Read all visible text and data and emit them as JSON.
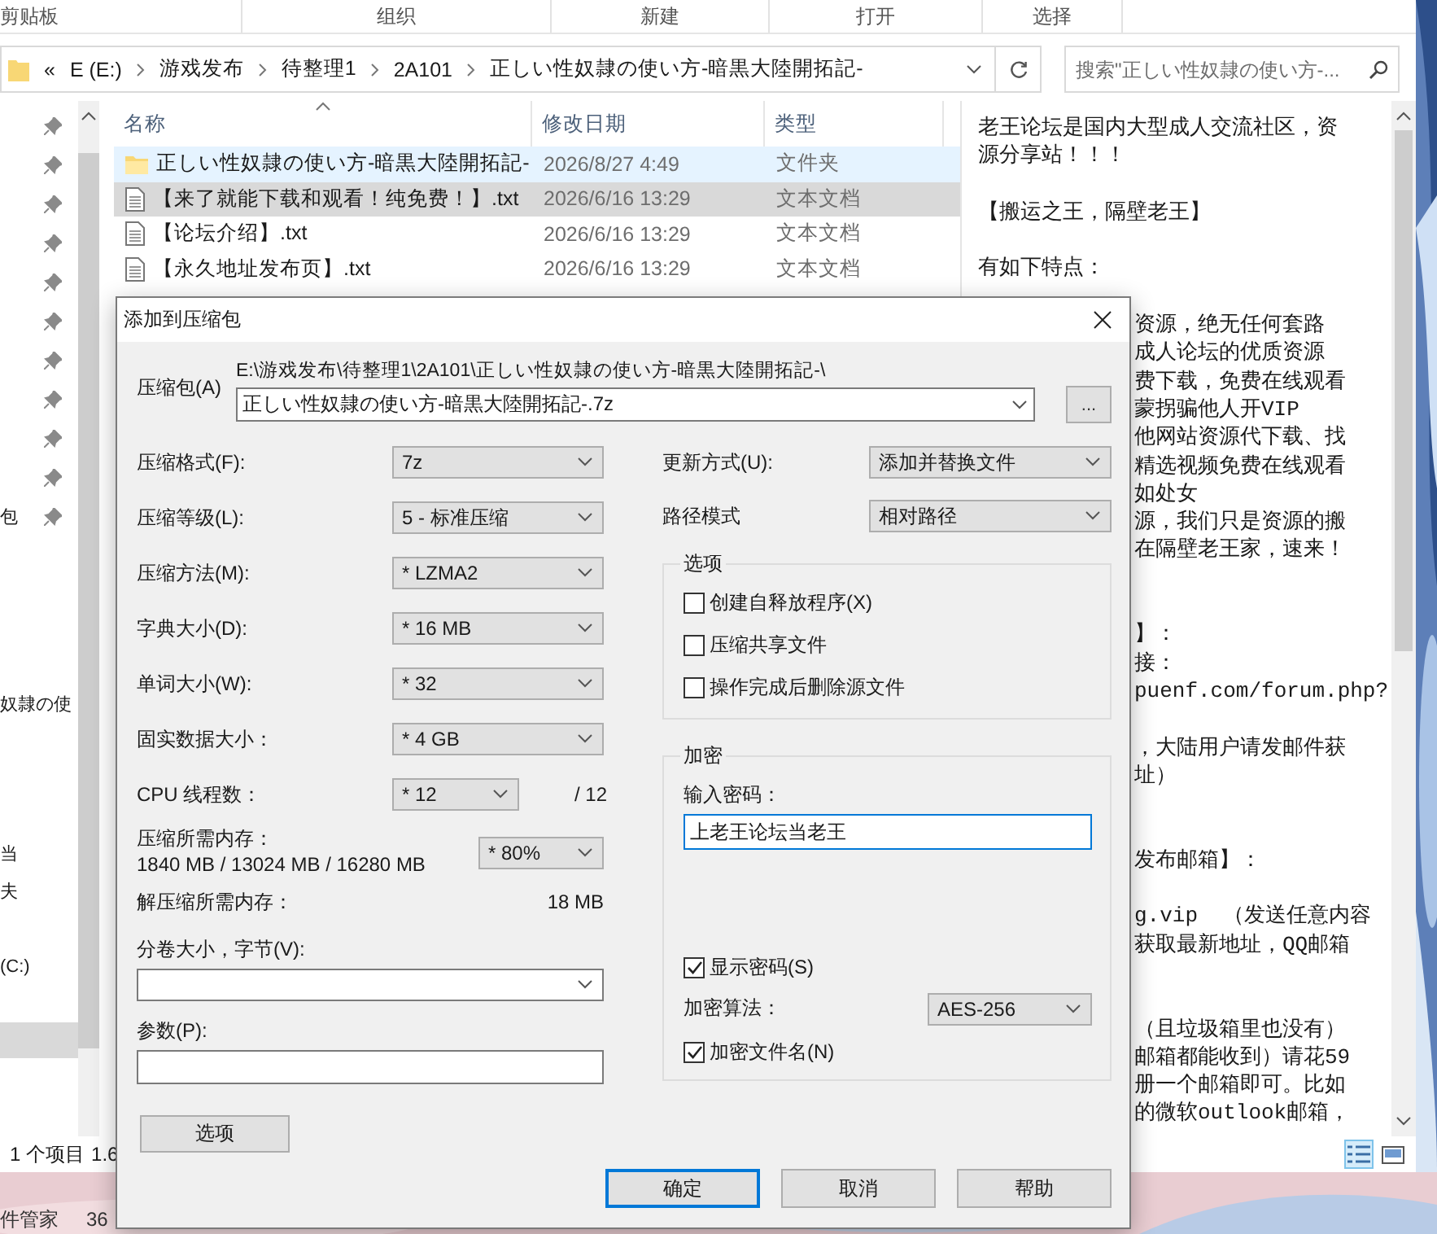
{
  "ribbon": {
    "groups": [
      "剪贴板",
      "组织",
      "新建",
      "打开",
      "选择"
    ]
  },
  "address": {
    "back": "«",
    "path": [
      "E (E:)",
      "游戏发布",
      "待整理1",
      "2A101",
      "正しい性奴隷の使い方-暗黒大陸開拓記-"
    ],
    "search": {
      "placeholder": "搜索\"正しい性奴隷の使い方-..."
    }
  },
  "nav": {
    "items": [
      {
        "kind": "pinned",
        "selected": false
      },
      {
        "kind": "pinned",
        "selected": false
      },
      {
        "kind": "pinned",
        "selected": false
      },
      {
        "kind": "pinned",
        "selected": false
      },
      {
        "kind": "pinned",
        "selected": false
      },
      {
        "kind": "pinned",
        "selected": false
      },
      {
        "kind": "pinned",
        "selected": false
      },
      {
        "kind": "pinned",
        "selected": false
      },
      {
        "kind": "pinned",
        "selected": false
      },
      {
        "kind": "pinned",
        "selected": false
      },
      {
        "kind": "pinned",
        "text": "包",
        "selected": false
      },
      {
        "kind": "blank",
        "selected": false
      },
      {
        "kind": "blank",
        "selected": false
      },
      {
        "kind": "blank",
        "selected": false
      },
      {
        "kind": "blank",
        "selected": false
      },
      {
        "kind": "label",
        "text": "奴隷の使",
        "selected": false
      },
      {
        "kind": "blank",
        "selected": false
      },
      {
        "kind": "blank",
        "selected": false
      },
      {
        "kind": "blank",
        "selected": false
      },
      {
        "kind": "label",
        "text": "当",
        "selected": false
      },
      {
        "kind": "label",
        "text": "夫",
        "selected": false
      },
      {
        "kind": "blank",
        "selected": false
      },
      {
        "kind": "label",
        "text": "(C:)",
        "selected": false
      },
      {
        "kind": "blank",
        "selected": false
      },
      {
        "kind": "blank",
        "selected": true
      }
    ]
  },
  "files": {
    "columns": [
      "名称",
      "修改日期",
      "类型"
    ],
    "rows": [
      {
        "kind": "folder",
        "name": "正しい性奴隷の使い方-暗黒大陸開拓記-",
        "date": "2026/8/27 4:49",
        "type": "文件夹",
        "hovered": true,
        "selected": false
      },
      {
        "kind": "text",
        "name": "【来了就能下载和观看！纯免费！】.txt",
        "date": "2026/6/16 13:29",
        "type": "文本文档",
        "hovered": false,
        "selected": true
      },
      {
        "kind": "text",
        "name": "【论坛介绍】.txt",
        "date": "2026/6/16 13:29",
        "type": "文本文档",
        "hovered": false,
        "selected": false
      },
      {
        "kind": "text",
        "name": "【永久地址发布页】.txt",
        "date": "2026/6/16 13:29",
        "type": "文本文档",
        "hovered": false,
        "selected": false
      }
    ]
  },
  "preview": {
    "lines": [
      {
        "kind": "full",
        "text": "老王论坛是国内大型成人交流社区，资"
      },
      {
        "kind": "full",
        "text": "源分享站！！！"
      },
      {
        "kind": "blank"
      },
      {
        "kind": "full",
        "text": "【搬运之王，隔壁老王】"
      },
      {
        "kind": "blank"
      },
      {
        "kind": "full",
        "text": "有如下特点："
      },
      {
        "kind": "blank"
      },
      {
        "kind": "partial",
        "text": "资源，绝无任何套路"
      },
      {
        "kind": "partial",
        "text": "成人论坛的优质资源"
      },
      {
        "kind": "partial",
        "text": "费下载，免费在线观看"
      },
      {
        "kind": "partial",
        "text": "蒙拐骗他人开VIP"
      },
      {
        "kind": "partial",
        "text": "他网站资源代下载、找"
      },
      {
        "kind": "partial",
        "text": "精选视频免费在线观看"
      },
      {
        "kind": "partial",
        "text": "如处女"
      },
      {
        "kind": "partial",
        "text": "源，我们只是资源的搬"
      },
      {
        "kind": "partial",
        "text": "在隔壁老王家，速来！"
      },
      {
        "kind": "blank"
      },
      {
        "kind": "blank"
      },
      {
        "kind": "partial",
        "text": "】："
      },
      {
        "kind": "partial",
        "text": "接："
      },
      {
        "kind": "partial",
        "text": "puenf.com/forum.php?"
      },
      {
        "kind": "blank"
      },
      {
        "kind": "partial",
        "text": "，大陆用户请发邮件获"
      },
      {
        "kind": "partial",
        "text": "址）"
      },
      {
        "kind": "blank"
      },
      {
        "kind": "blank"
      },
      {
        "kind": "partial",
        "text": "发布邮箱】："
      },
      {
        "kind": "blank"
      },
      {
        "kind": "partial",
        "text": "g.vip  （发送任意内容"
      },
      {
        "kind": "partial",
        "text": "获取最新地址，QQ邮箱"
      },
      {
        "kind": "blank"
      },
      {
        "kind": "blank"
      },
      {
        "kind": "partial",
        "text": "（且垃圾箱里也没有）"
      },
      {
        "kind": "partial",
        "text": "邮箱都能收到）请花59"
      },
      {
        "kind": "partial",
        "text": "册一个邮箱即可。比如"
      },
      {
        "kind": "partial",
        "text": "的微软outlook邮箱，"
      }
    ]
  },
  "status_bar": {
    "count": "1 个项目",
    "size": "1.6"
  },
  "desktop": {
    "labels": [
      "件管家",
      "36"
    ]
  },
  "dialog": {
    "title": "添加到压缩包",
    "archive": {
      "label": "压缩包(A)",
      "path": "E:\\游戏发布\\待整理1\\2A101\\正しい性奴隷の使い方-暗黒大陸開拓記-\\",
      "value": "正しい性奴隷の使い方-暗黒大陸開拓記-.7z",
      "browse": "..."
    },
    "left_fields": [
      {
        "label": "压缩格式(F):",
        "value": "7z"
      },
      {
        "label": "压缩等级(L):",
        "value": "5 - 标准压缩"
      },
      {
        "label": "压缩方法(M):",
        "value": "* LZMA2"
      },
      {
        "label": "字典大小(D):",
        "value": "* 16 MB"
      },
      {
        "label": "单词大小(W):",
        "value": "* 32"
      },
      {
        "label": "固实数据大小：",
        "value": "* 4 GB"
      },
      {
        "label": "CPU 线程数：",
        "value": "* 12",
        "suffix": "/ 12"
      }
    ],
    "memory": {
      "label": "压缩所需内存：",
      "detail": "1840 MB / 13024 MB / 16280 MB",
      "value": "* 80%"
    },
    "decompress": {
      "label": "解压缩所需内存：",
      "value": "18 MB"
    },
    "volume": {
      "label": "分卷大小，字节(V):"
    },
    "params": {
      "label": "参数(P):"
    },
    "options_button": "选项",
    "update_mode": {
      "label": "更新方式(U):",
      "value": "添加并替换文件"
    },
    "path_mode": {
      "label": "路径模式",
      "value": "相对路径"
    },
    "options": {
      "title": "选项",
      "items": [
        {
          "label": "创建自释放程序(X)",
          "checked": false
        },
        {
          "label": "压缩共享文件",
          "checked": false
        },
        {
          "label": "操作完成后删除源文件",
          "checked": false
        }
      ]
    },
    "encryption": {
      "title": "加密",
      "password_label": "输入密码：",
      "password": "上老王论坛当老王",
      "show_password": {
        "label": "显示密码(S)",
        "checked": true
      },
      "method_label": "加密算法：",
      "method": "AES-256",
      "encrypt_names": {
        "label": "加密文件名(N)",
        "checked": true
      }
    },
    "buttons": [
      {
        "label": "确定",
        "default": true
      },
      {
        "label": "取消",
        "default": false
      },
      {
        "label": "帮助",
        "default": false
      }
    ]
  }
}
